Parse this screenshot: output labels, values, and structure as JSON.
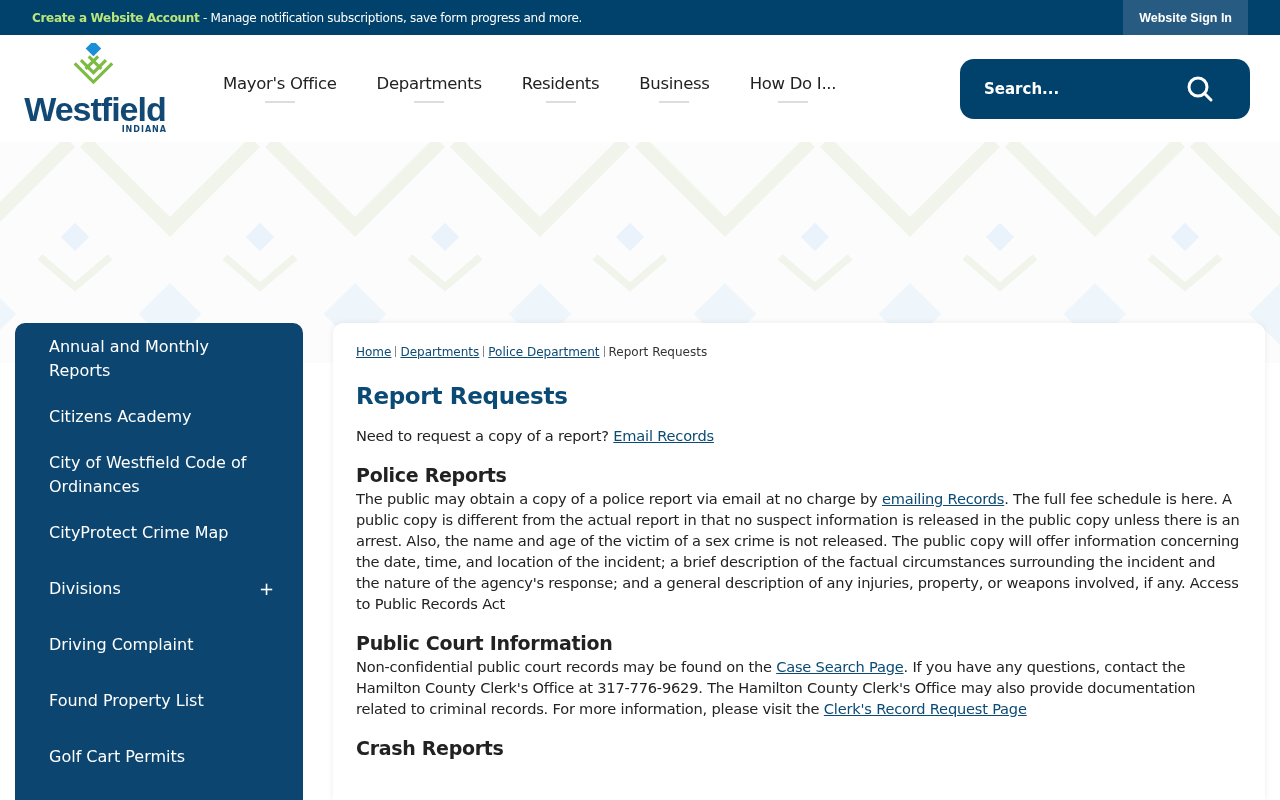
{
  "top_bar": {
    "account_link": "Create a Website Account",
    "message": "- Manage notification subscriptions, save form progress and more.",
    "sign_in": "Website Sign In"
  },
  "header": {
    "logo": {
      "name": "Westfield",
      "state": "INDIANA"
    },
    "nav": [
      "Mayor's Office",
      "Departments",
      "Residents",
      "Business",
      "How Do I..."
    ],
    "search": {
      "placeholder": "Search..."
    }
  },
  "sidebar": {
    "items": [
      {
        "label": "Annual and Monthly Reports"
      },
      {
        "label": "Citizens Academy"
      },
      {
        "label": "City of Westfield Code of Ordinances"
      },
      {
        "label": "CityProtect Crime Map"
      },
      {
        "label": "Divisions",
        "toggle": "+"
      },
      {
        "label": "Driving Complaint"
      },
      {
        "label": "Found Property List"
      },
      {
        "label": "Golf Cart Permits"
      }
    ]
  },
  "content": {
    "breadcrumbs": [
      {
        "label": "Home",
        "link": true
      },
      {
        "label": "Departments",
        "link": true
      },
      {
        "label": "Police Department",
        "link": true
      },
      {
        "label": "Report Requests",
        "link": false
      }
    ],
    "title": "Report Requests",
    "sections": [
      {
        "kind": "paragraph",
        "parts": [
          {
            "kind": "text",
            "text": "Need to request a copy of a report? "
          },
          {
            "kind": "link",
            "text": "Email Records"
          }
        ]
      },
      {
        "kind": "heading",
        "text": "Police Reports"
      },
      {
        "kind": "paragraph",
        "parts": [
          {
            "kind": "text",
            "text": "The public may obtain a copy of a police report via email at no charge by "
          },
          {
            "kind": "link",
            "text": "emailing Records"
          },
          {
            "kind": "text",
            "text": ". The full fee schedule is here. A public copy is different from the actual report in that no suspect information is released in the public copy unless there is an arrest. Also, the name and age of the victim of a sex crime is not released. The public copy will offer information concerning the date, time, and location of the incident; a brief description of the factual circumstances surrounding the incident and the nature of the agency's response; and a general description of any injuries, property, or weapons involved, if any. Access to Public Records Act"
          }
        ]
      },
      {
        "kind": "heading",
        "text": "Public Court Information"
      },
      {
        "kind": "paragraph",
        "parts": [
          {
            "kind": "text",
            "text": "Non-confidential public court records may be found on the "
          },
          {
            "kind": "link",
            "text": "Case Search Page"
          },
          {
            "kind": "text",
            "text": ". If you have any questions, contact the Hamilton County Clerk's Office at 317-776-9629. The Hamilton County Clerk's Office may also provide documentation related to criminal records. For more information, please visit the "
          },
          {
            "kind": "link",
            "text": "Clerk's Record Request Page"
          }
        ]
      },
      {
        "kind": "heading",
        "text": "Crash Reports"
      }
    ]
  }
}
